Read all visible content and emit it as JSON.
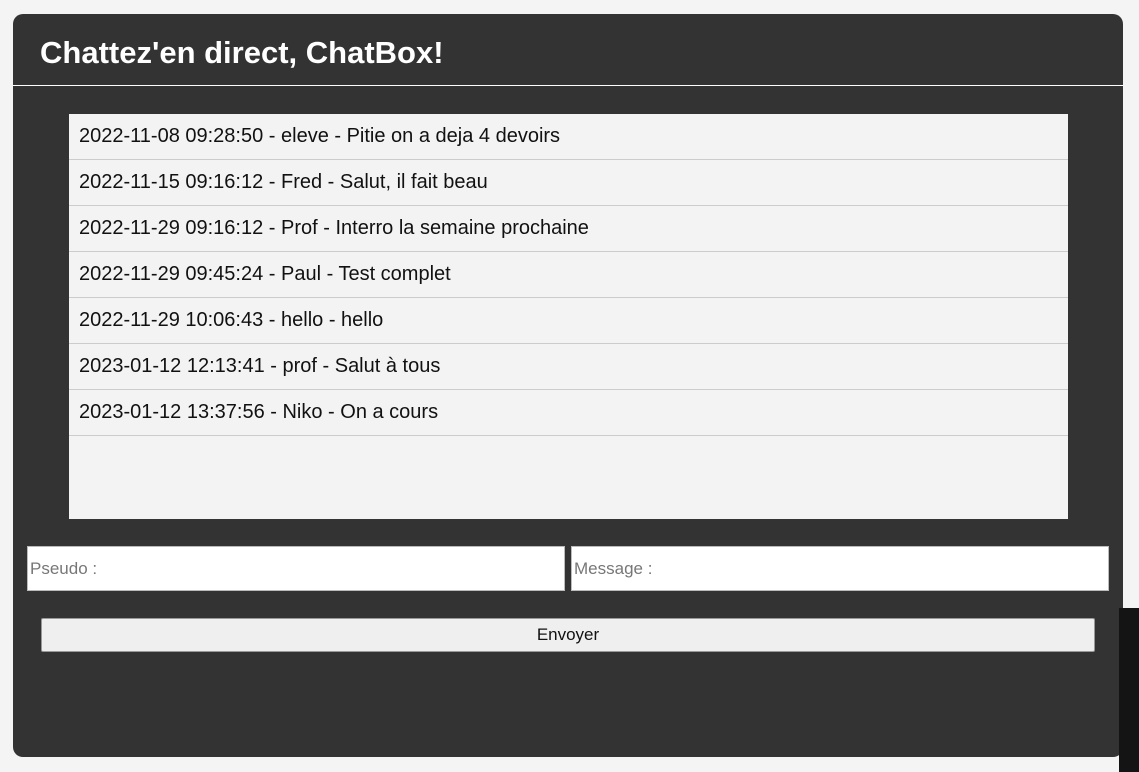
{
  "header": {
    "title": "Chattez'en direct, ChatBox!"
  },
  "messages": [
    "2022-11-08 09:28:50 - eleve - Pitie on a deja 4 devoirs",
    "2022-11-15 09:16:12 - Fred - Salut, il fait beau",
    "2022-11-29 09:16:12 - Prof - Interro la semaine prochaine",
    "2022-11-29 09:45:24 - Paul - Test complet",
    "2022-11-29 10:06:43 - hello - hello",
    "2023-01-12 12:13:41 - prof - Salut à tous",
    "2023-01-12 13:37:56 - Niko - On a cours"
  ],
  "form": {
    "pseudo_placeholder": "Pseudo :",
    "pseudo_value": "",
    "message_placeholder": "Message :",
    "message_value": "",
    "send_label": "Envoyer"
  },
  "colors": {
    "panel_background": "#333333",
    "message_list_background": "#f3f3f3",
    "page_background": "#f4f4f4"
  }
}
